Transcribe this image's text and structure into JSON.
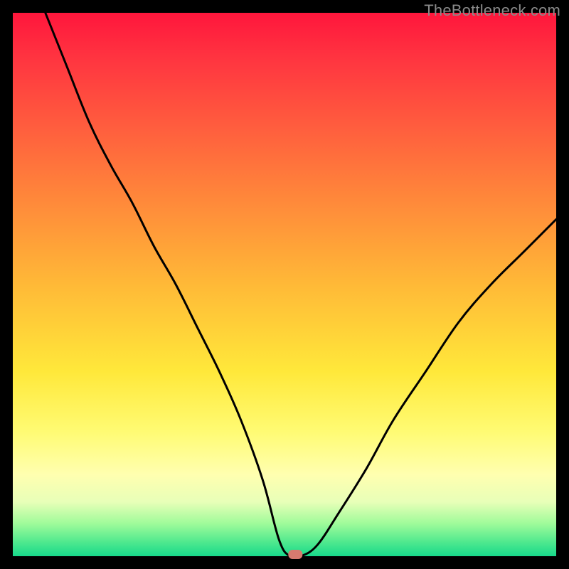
{
  "watermark": "TheBottleneck.com",
  "chart_data": {
    "type": "line",
    "title": "",
    "xlabel": "",
    "ylabel": "",
    "xlim": [
      0,
      100
    ],
    "ylim": [
      0,
      100
    ],
    "gradient_stops": [
      {
        "pct": 0,
        "color": "#ff163c"
      },
      {
        "pct": 8,
        "color": "#ff3340"
      },
      {
        "pct": 20,
        "color": "#ff5a3e"
      },
      {
        "pct": 35,
        "color": "#ff8a3a"
      },
      {
        "pct": 50,
        "color": "#ffb937"
      },
      {
        "pct": 66,
        "color": "#ffe83a"
      },
      {
        "pct": 77,
        "color": "#fffb73"
      },
      {
        "pct": 85,
        "color": "#ffffb0"
      },
      {
        "pct": 90,
        "color": "#e8ffb8"
      },
      {
        "pct": 94,
        "color": "#9ffb9a"
      },
      {
        "pct": 97.5,
        "color": "#4de88e"
      },
      {
        "pct": 100,
        "color": "#17d98b"
      }
    ],
    "series": [
      {
        "name": "bottleneck-curve",
        "x": [
          6,
          10,
          14,
          18,
          22,
          26,
          30,
          34,
          38,
          42,
          46,
          49,
          51,
          53,
          56,
          60,
          65,
          70,
          76,
          82,
          88,
          94,
          100
        ],
        "y": [
          100,
          90,
          80,
          72,
          65,
          57,
          50,
          42,
          34,
          25,
          14,
          3,
          0,
          0,
          2,
          8,
          16,
          25,
          34,
          43,
          50,
          56,
          62
        ]
      }
    ],
    "marker": {
      "x": 52,
      "y": 0,
      "color": "#d77a6f"
    },
    "grid": false,
    "legend": false
  }
}
